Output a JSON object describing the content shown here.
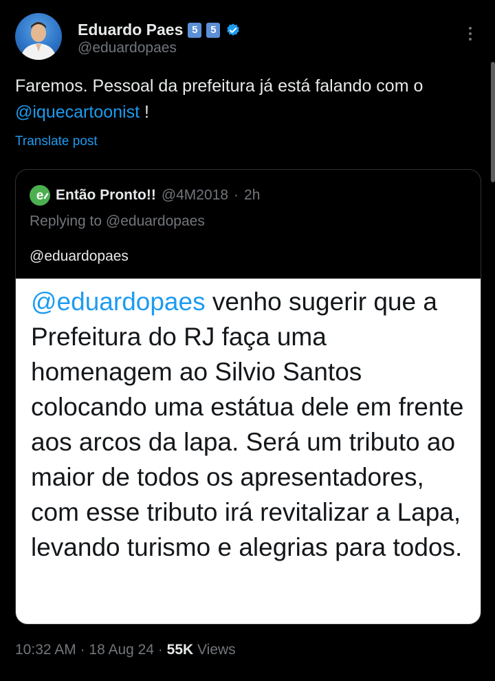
{
  "author": {
    "display_name": "Eduardo Paes",
    "badges": [
      "5",
      "5"
    ],
    "verified_icon": "verified-badge-icon",
    "handle": "@eduardopaes",
    "avatar_icon": "profile-photo"
  },
  "post": {
    "text_before": "Faremos.  Pessoal da prefeitura já está falando com o ",
    "mention": "@iquecartoonist",
    "text_after": " !",
    "translate_label": "Translate post"
  },
  "quoted": {
    "logo_icon": "e-logo-icon",
    "display_name": "Então Pronto!!",
    "handle": "@4M2018",
    "separator": "·",
    "time": "2h",
    "replying_to": "Replying to @eduardopaes",
    "text": "@eduardopaes",
    "image_text": {
      "mention": "@eduardopaes",
      "body": " venho sugerir que a Prefeitura do RJ faça uma homenagem ao Silvio Santos colocando uma estátua dele em frente aos arcos da lapa. Será um tributo ao maior de todos os apresentadores, com esse tributo irá revitalizar a Lapa, levando turismo e alegrias para todos."
    }
  },
  "footer": {
    "time": "10:32 AM",
    "sep1": " · ",
    "date": "18 Aug 24",
    "sep2": " · ",
    "views_count": "55K",
    "views_label": " Views"
  },
  "colors": {
    "background": "#000000",
    "text": "#e7e9ea",
    "muted": "#71767b",
    "accent": "#1d9bf0"
  }
}
